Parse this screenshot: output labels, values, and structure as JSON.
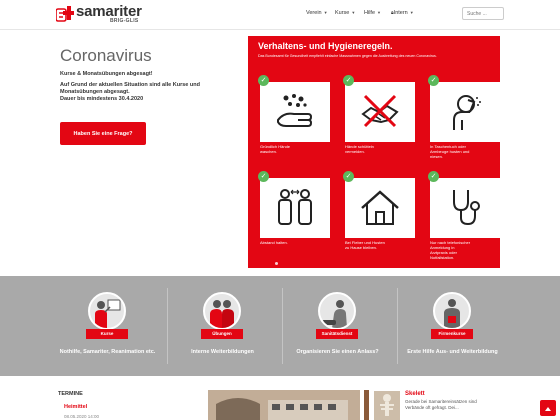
{
  "brand": {
    "name": "samariter",
    "sub": "BRIG-GLIS",
    "accent": "#e30613"
  },
  "nav": {
    "items": [
      "Verein",
      "Kurse",
      "Hilfe",
      "Intern"
    ],
    "search_placeholder": "Suche ..."
  },
  "hero": {
    "title": "Coronavirus",
    "subtitle": "Kurse & Monatsübungen abgesagt!",
    "body_lines": [
      "Auf Grund der aktuellen Situation sind alle Kurse und",
      "Monatsübungen abgesagt.",
      "Dauer bis mindestens 30.4.2020"
    ],
    "cta": "Haben Sie eine Frage?"
  },
  "poster": {
    "title": "Verhaltens- und Hygieneregeln.",
    "description": "Das Bundesamt für Gesundheit empfiehlt einfache Massnahmen gegen die Ausbreitung des neuen Coronavirus.",
    "rules": [
      {
        "icon": "hand-washing-icon",
        "caption_lines": [
          "Gründlich Hände",
          "waschen."
        ]
      },
      {
        "icon": "no-handshake-icon",
        "caption_lines": [
          "Hände schütteln",
          "vermeiden."
        ]
      },
      {
        "icon": "cough-elbow-icon",
        "caption_lines": [
          "In Taschentuch oder",
          "Armbeuge husten und",
          "niesen."
        ]
      },
      {
        "icon": "keep-distance-icon",
        "caption_lines": [
          "Abstand halten."
        ]
      },
      {
        "icon": "stay-home-icon",
        "caption_lines": [
          "Bei Fieber und Husten",
          "zu Hause bleiben."
        ]
      },
      {
        "icon": "stethoscope-icon",
        "caption_lines": [
          "Nur nach telefonischer",
          "Anmeldung in",
          "Arztpraxis oder",
          "Notfallstation."
        ]
      }
    ]
  },
  "services": [
    {
      "badge": "Kurse",
      "link": "Nothilfe, Samariter, Reanimation etc."
    },
    {
      "badge": "Übungen",
      "link": "Interne Weiterbildungen"
    },
    {
      "badge": "Sanitätsdienst",
      "link": "Organisieren Sie einen Anlass?"
    },
    {
      "badge": "Firmenkurse",
      "link": "Erste Hilfe Aus- und Weiterbildung"
    }
  ],
  "termine": {
    "heading": "TERMINE",
    "event_title": "Heimittel",
    "event_date": "08.05.2020 14:00"
  },
  "news": {
    "title": "Skelett",
    "text": "Gerade bei Samaritereinsätzen sind Verbände oft gefragt. Dei..."
  }
}
